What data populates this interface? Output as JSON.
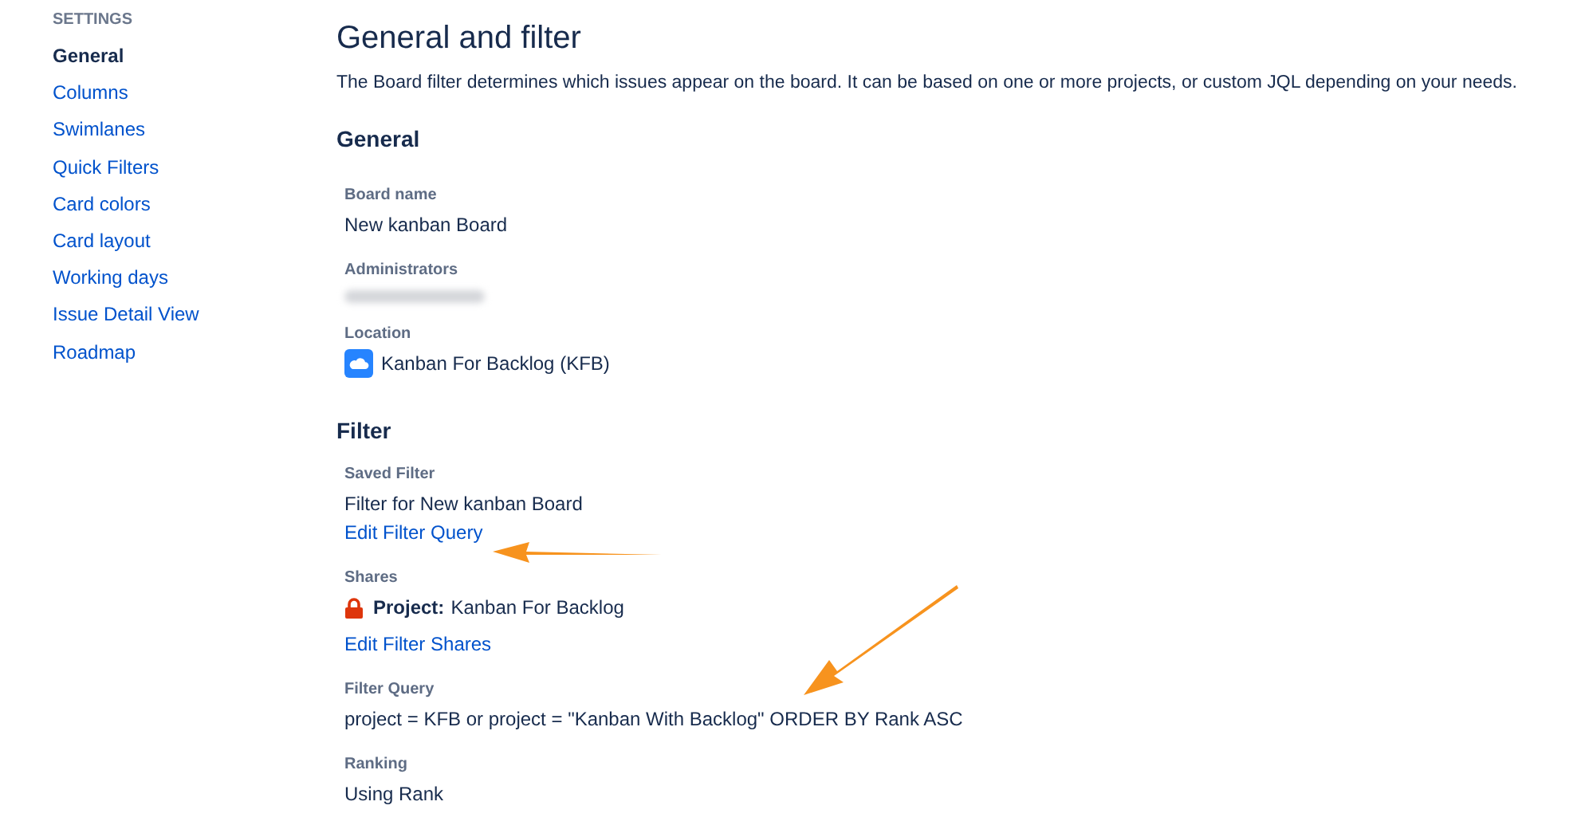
{
  "sidebar": {
    "heading": "SETTINGS",
    "items": [
      {
        "label": "General",
        "selected": true
      },
      {
        "label": "Columns",
        "selected": false
      },
      {
        "label": "Swimlanes",
        "selected": false
      },
      {
        "label": "Quick Filters",
        "selected": false
      },
      {
        "label": "Card colors",
        "selected": false
      },
      {
        "label": "Card layout",
        "selected": false
      },
      {
        "label": "Working days",
        "selected": false
      },
      {
        "label": "Issue Detail View",
        "selected": false
      },
      {
        "label": "Roadmap",
        "selected": false
      }
    ]
  },
  "page": {
    "title": "General and filter",
    "description": "The Board filter determines which issues appear on the board. It can be based on one or more projects, or custom JQL depending on your needs.",
    "sections": [
      {
        "heading": "General",
        "fields": [
          {
            "label": "Board name",
            "items": [
              {
                "kind": "text",
                "text": "New kanban Board"
              }
            ]
          },
          {
            "label": "Administrators",
            "items": [
              {
                "kind": "blurred"
              }
            ]
          },
          {
            "label": "Location",
            "items": [
              {
                "kind": "project",
                "text": "Kanban For Backlog (KFB)"
              }
            ]
          }
        ]
      },
      {
        "heading": "Filter",
        "fields": [
          {
            "label": "Saved Filter",
            "items": [
              {
                "kind": "text",
                "text": "Filter for New kanban Board"
              },
              {
                "kind": "link",
                "text": "Edit Filter Query"
              }
            ]
          },
          {
            "label": "Shares",
            "items": [
              {
                "kind": "share",
                "prefix": "Project:",
                "text": "Kanban For Backlog"
              },
              {
                "kind": "link",
                "text": "Edit Filter Shares"
              }
            ]
          },
          {
            "label": "Filter Query",
            "items": [
              {
                "kind": "text",
                "text": "project = KFB or project = \"Kanban With Backlog\" ORDER BY Rank ASC"
              }
            ]
          },
          {
            "label": "Ranking",
            "items": [
              {
                "kind": "text",
                "text": "Using Rank"
              }
            ]
          }
        ]
      }
    ]
  }
}
